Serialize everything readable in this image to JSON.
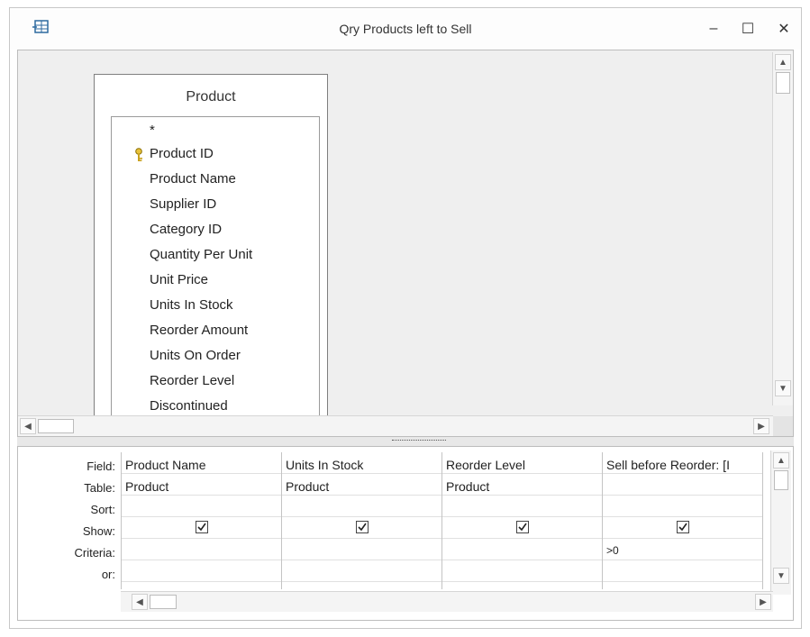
{
  "window": {
    "title": "Qry Products left to Sell",
    "minimize": "–",
    "maximize": "☐",
    "close": "✕"
  },
  "table": {
    "name": "Product",
    "all_fields": "*",
    "fields": [
      "Product ID",
      "Product Name",
      "Supplier ID",
      "Category ID",
      "Quantity Per Unit",
      "Unit Price",
      "Units In Stock",
      "Reorder Amount",
      "Units On Order",
      "Reorder Level",
      "Discontinued"
    ],
    "primary_key": "Product ID"
  },
  "grid": {
    "row_labels": [
      "Field:",
      "Table:",
      "Sort:",
      "Show:",
      "Criteria:",
      "or:"
    ],
    "columns": [
      {
        "field": "Product Name",
        "table": "Product",
        "sort": "",
        "show": true,
        "criteria": ""
      },
      {
        "field": "Units In Stock",
        "table": "Product",
        "sort": "",
        "show": true,
        "criteria": ""
      },
      {
        "field": "Reorder Level",
        "table": "Product",
        "sort": "",
        "show": true,
        "criteria": ""
      },
      {
        "field": "Sell before Reorder: [I",
        "table": "",
        "sort": "",
        "show": true,
        "criteria": ">0"
      }
    ]
  },
  "scroll": {
    "up": "▲",
    "down": "▼",
    "left": "◀",
    "right": "▶"
  }
}
